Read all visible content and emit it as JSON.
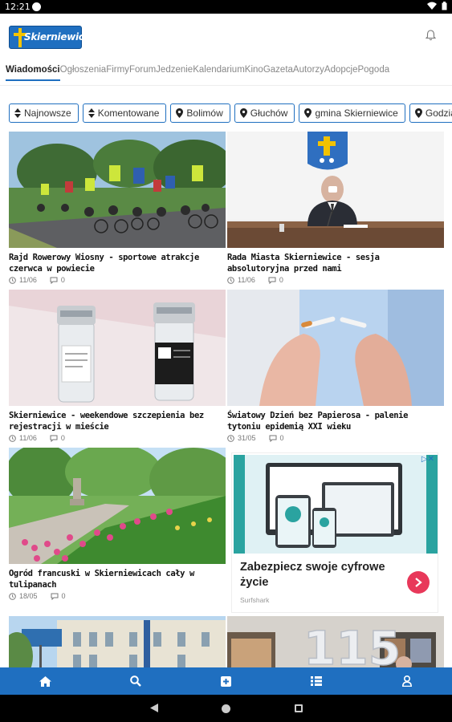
{
  "status_bar": {
    "time": "12:21"
  },
  "app": {
    "logo_text": "Skierniewice"
  },
  "tabs": [
    {
      "label": "Wiadomości",
      "active": true
    },
    {
      "label": "Ogłoszenia"
    },
    {
      "label": "Firmy"
    },
    {
      "label": "Forum"
    },
    {
      "label": "Jedzenie"
    },
    {
      "label": "Kalendarium"
    },
    {
      "label": "Kino"
    },
    {
      "label": "Gazeta"
    },
    {
      "label": "Autorzy"
    },
    {
      "label": "Adopcje"
    },
    {
      "label": "Pogoda"
    }
  ],
  "filters": [
    {
      "label": "Najnowsze",
      "icon": "sort-icon"
    },
    {
      "label": "Komentowane",
      "icon": "sort-icon"
    },
    {
      "label": "Bolimów",
      "icon": "map-marker-icon"
    },
    {
      "label": "Głuchów",
      "icon": "map-marker-icon"
    },
    {
      "label": "gmina Skierniewice",
      "icon": "map-marker-icon"
    },
    {
      "label": "Godzianów",
      "icon": "map-marker-icon"
    }
  ],
  "articles": [
    {
      "title": "Rajd Rowerowy Wiosny - sportowe atrakcje czerwca w powiecie",
      "date": "11/06",
      "comments": "0",
      "image": "cyclists-photo"
    },
    {
      "title": "Rada Miasta Skierniewice - sesja absolutoryjna przed nami",
      "date": "11/06",
      "comments": "0",
      "image": "city-council-photo"
    },
    {
      "title": "Skierniewice - weekendowe szczepienia bez rejestracji w mieście",
      "date": "11/06",
      "comments": "0",
      "image": "vaccine-vials-photo"
    },
    {
      "title": "Światowy Dzień bez Papierosa - palenie tytoniu epidemią XXI wieku",
      "date": "31/05",
      "comments": "0",
      "image": "broken-cigarette-photo"
    },
    {
      "title": "Ogród francuski w Skierniewicach cały w tulipanach",
      "date": "18/05",
      "comments": "0",
      "image": "tulip-garden-photo"
    },
    {
      "title": "",
      "date": "",
      "comments": "",
      "image": "building-photo"
    },
    {
      "title": "",
      "date": "",
      "comments": "",
      "image": "anniversary-photo"
    }
  ],
  "ad": {
    "title": "Zabezpiecz swoje cyfrowe życie",
    "brand": "Surfshark",
    "close": "▷✕"
  },
  "colors": {
    "brand": "#1f6fc0",
    "ad_button": "#e8385a"
  }
}
